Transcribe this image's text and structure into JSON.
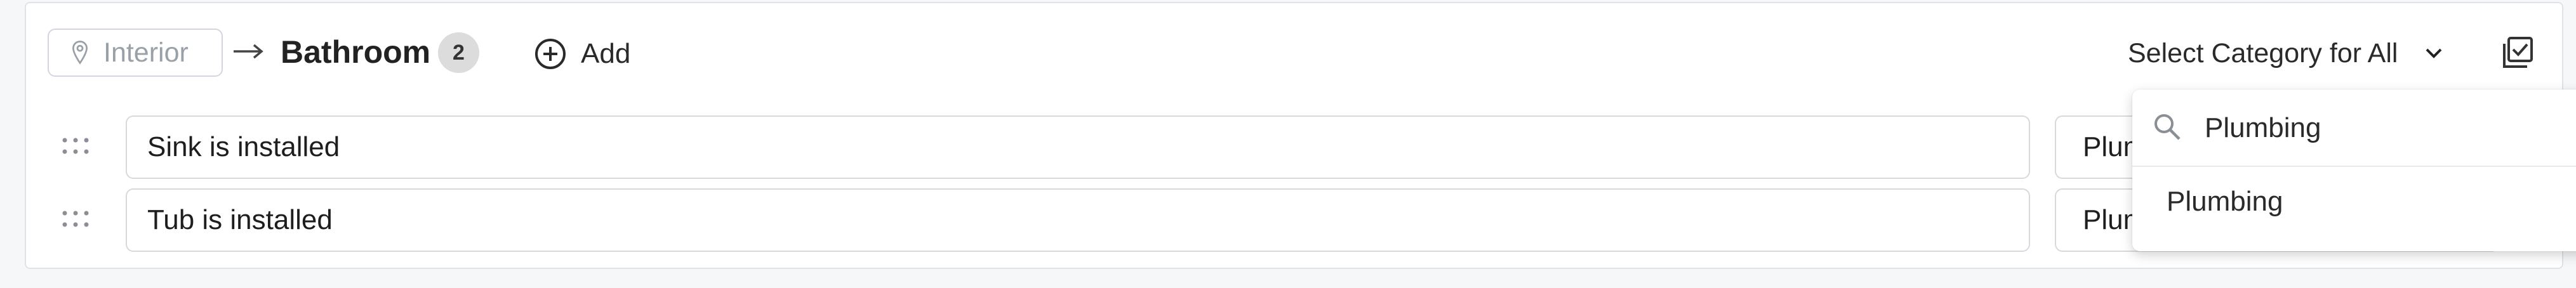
{
  "header": {
    "location_label": "Interior",
    "room_title": "Bathroom",
    "item_count": "2",
    "add_label": "Add",
    "category_select_label": "Select Category for All"
  },
  "items": [
    {
      "name": "Sink is installed",
      "category": "Plumbing"
    },
    {
      "name": "Tub is installed",
      "category": "Plumbing"
    }
  ],
  "dropdown": {
    "search_value": "Plumbing",
    "options": [
      "Plumbing"
    ]
  },
  "icons": {
    "location": "map-pin-icon",
    "arrow": "arrow-right-icon",
    "add": "plus-circle-icon",
    "chevron": "chevron-down-icon",
    "check_all": "select-all-checkbox-icon",
    "drag": "drag-handle-icon",
    "search": "search-icon"
  },
  "colors": {
    "badge_bg": "#dcdcdc",
    "border": "#d6d9de",
    "muted_text": "#9aa0a7"
  }
}
